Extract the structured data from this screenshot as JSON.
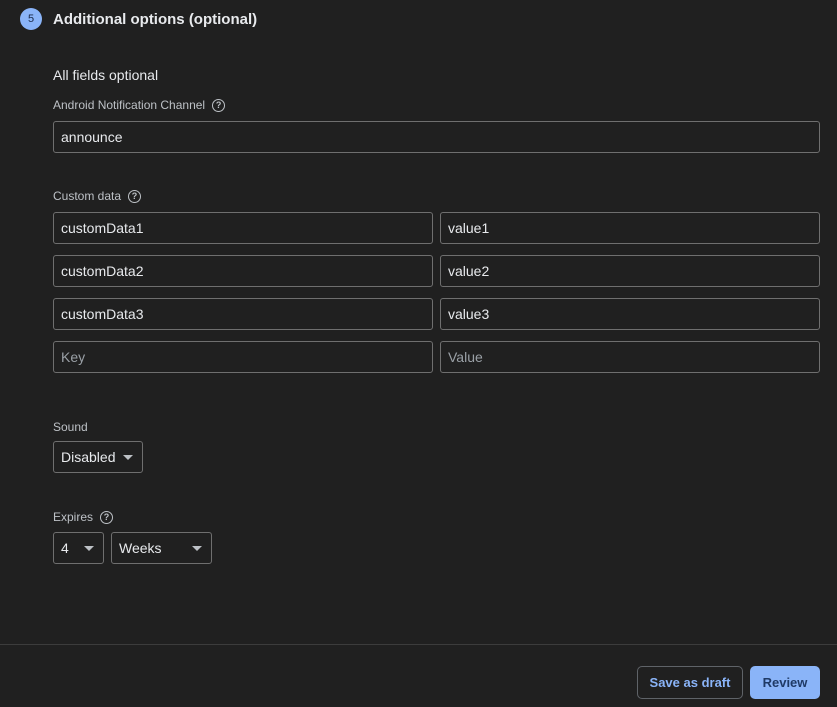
{
  "step": {
    "number": "5",
    "title": "Additional options (optional)"
  },
  "subheading": "All fields optional",
  "notification_channel": {
    "label": "Android Notification Channel",
    "help_icon": "help-icon",
    "value": "announce"
  },
  "custom_data": {
    "label": "Custom data",
    "help_icon": "help-icon",
    "rows": [
      {
        "key": "customData1",
        "value": "value1"
      },
      {
        "key": "customData2",
        "value": "value2"
      },
      {
        "key": "customData3",
        "value": "value3"
      }
    ],
    "empty_row": {
      "key_placeholder": "Key",
      "value_placeholder": "Value"
    }
  },
  "sound": {
    "label": "Sound",
    "selected": "Disabled"
  },
  "expires": {
    "label": "Expires",
    "help_icon": "help-icon",
    "amount": "4",
    "unit": "Weeks"
  },
  "footer": {
    "save_draft_label": "Save as draft",
    "review_label": "Review"
  },
  "colors": {
    "accent": "#8ab4f8",
    "background": "#202020"
  }
}
